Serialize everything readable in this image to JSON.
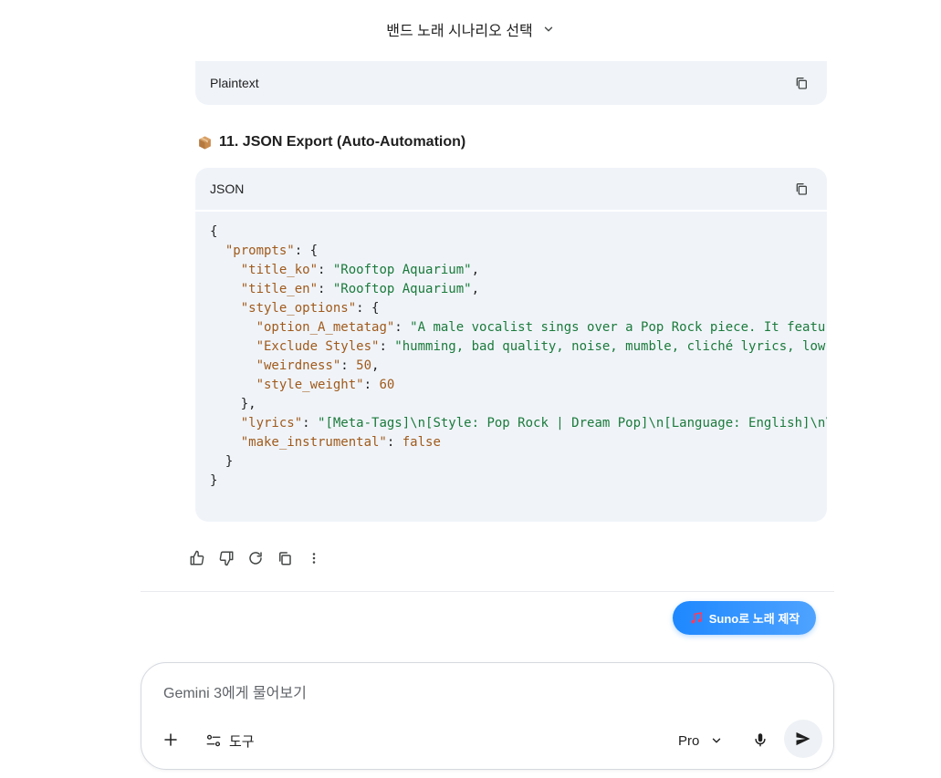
{
  "header": {
    "title": "밴드 노래 시나리오 선택",
    "title_icon": "chevron-down-icon"
  },
  "plaintext_block": {
    "language_label": "Plaintext",
    "copy_icon": "copy-icon"
  },
  "section": {
    "heading": "11. JSON Export (Auto-Automation)",
    "heading_icon": "package-box-icon"
  },
  "json_block": {
    "language_label": "JSON",
    "copy_icon": "copy-icon",
    "lines": {
      "l1": "{",
      "l2_key": "\"prompts\"",
      "l2_tail": ": {",
      "l3_key": "\"title_ko\"",
      "l3_val": "\"Rooftop Aquarium\"",
      "l4_key": "\"title_en\"",
      "l4_val": "\"Rooftop Aquarium\"",
      "l5_key": "\"style_options\"",
      "l5_tail": ": {",
      "l6_key": "\"option_A_metatag\"",
      "l6_val": "\"A male vocalist sings over a Pop Rock piece. It featu",
      "l7_key": "\"Exclude Styles\"",
      "l7_val": "\"humming, bad quality, noise, mumble, cliché lyrics, low",
      "l8_key": "\"weirdness\"",
      "l8_val": "50",
      "l9_key": "\"style_weight\"",
      "l9_val": "60",
      "l10": "},",
      "l11_key": "\"lyrics\"",
      "l11_val": "\"[Meta-Tags]\\n[Style: Pop Rock | Dream Pop]\\n[Language: English]\\n\\",
      "l12_key": "\"make_instrumental\"",
      "l12_val": "false",
      "l13": "}",
      "l14": "}"
    }
  },
  "response_actions": [
    {
      "name": "thumbs-up-icon"
    },
    {
      "name": "thumbs-down-icon"
    },
    {
      "name": "regenerate-icon"
    },
    {
      "name": "copy-icon"
    },
    {
      "name": "more-vert-icon"
    }
  ],
  "suno_button": {
    "label": "Suno로 노래 제작",
    "icon": "music-note-icon"
  },
  "composer": {
    "placeholder": "Gemini 3에게 물어보기",
    "tools_label": "도구",
    "model_label": "Pro",
    "icons": [
      "plus-icon",
      "tools-icon",
      "chevron-down-icon",
      "mic-icon",
      "send-icon"
    ]
  },
  "colors": {
    "code_bg": "#f0f4f9",
    "json_key": "#a05a1b",
    "json_string": "#1b7a3b",
    "accent_blue": "#1e88ff"
  }
}
